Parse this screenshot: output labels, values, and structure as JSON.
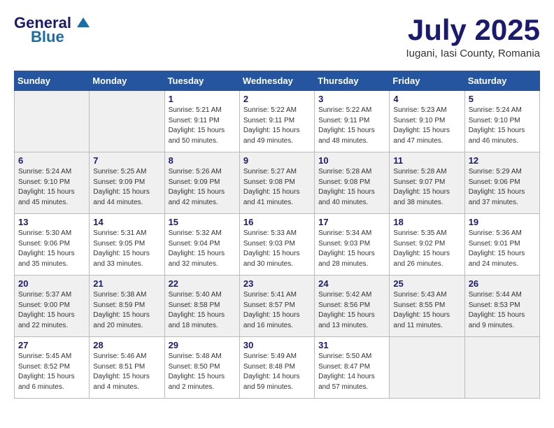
{
  "header": {
    "logo_general": "General",
    "logo_blue": "Blue",
    "month_year": "July 2025",
    "location": "Iugani, Iasi County, Romania"
  },
  "weekdays": [
    "Sunday",
    "Monday",
    "Tuesday",
    "Wednesday",
    "Thursday",
    "Friday",
    "Saturday"
  ],
  "weeks": [
    [
      {
        "day": "",
        "detail": ""
      },
      {
        "day": "",
        "detail": ""
      },
      {
        "day": "1",
        "detail": "Sunrise: 5:21 AM\nSunset: 9:11 PM\nDaylight: 15 hours\nand 50 minutes."
      },
      {
        "day": "2",
        "detail": "Sunrise: 5:22 AM\nSunset: 9:11 PM\nDaylight: 15 hours\nand 49 minutes."
      },
      {
        "day": "3",
        "detail": "Sunrise: 5:22 AM\nSunset: 9:11 PM\nDaylight: 15 hours\nand 48 minutes."
      },
      {
        "day": "4",
        "detail": "Sunrise: 5:23 AM\nSunset: 9:10 PM\nDaylight: 15 hours\nand 47 minutes."
      },
      {
        "day": "5",
        "detail": "Sunrise: 5:24 AM\nSunset: 9:10 PM\nDaylight: 15 hours\nand 46 minutes."
      }
    ],
    [
      {
        "day": "6",
        "detail": "Sunrise: 5:24 AM\nSunset: 9:10 PM\nDaylight: 15 hours\nand 45 minutes."
      },
      {
        "day": "7",
        "detail": "Sunrise: 5:25 AM\nSunset: 9:09 PM\nDaylight: 15 hours\nand 44 minutes."
      },
      {
        "day": "8",
        "detail": "Sunrise: 5:26 AM\nSunset: 9:09 PM\nDaylight: 15 hours\nand 42 minutes."
      },
      {
        "day": "9",
        "detail": "Sunrise: 5:27 AM\nSunset: 9:08 PM\nDaylight: 15 hours\nand 41 minutes."
      },
      {
        "day": "10",
        "detail": "Sunrise: 5:28 AM\nSunset: 9:08 PM\nDaylight: 15 hours\nand 40 minutes."
      },
      {
        "day": "11",
        "detail": "Sunrise: 5:28 AM\nSunset: 9:07 PM\nDaylight: 15 hours\nand 38 minutes."
      },
      {
        "day": "12",
        "detail": "Sunrise: 5:29 AM\nSunset: 9:06 PM\nDaylight: 15 hours\nand 37 minutes."
      }
    ],
    [
      {
        "day": "13",
        "detail": "Sunrise: 5:30 AM\nSunset: 9:06 PM\nDaylight: 15 hours\nand 35 minutes."
      },
      {
        "day": "14",
        "detail": "Sunrise: 5:31 AM\nSunset: 9:05 PM\nDaylight: 15 hours\nand 33 minutes."
      },
      {
        "day": "15",
        "detail": "Sunrise: 5:32 AM\nSunset: 9:04 PM\nDaylight: 15 hours\nand 32 minutes."
      },
      {
        "day": "16",
        "detail": "Sunrise: 5:33 AM\nSunset: 9:03 PM\nDaylight: 15 hours\nand 30 minutes."
      },
      {
        "day": "17",
        "detail": "Sunrise: 5:34 AM\nSunset: 9:03 PM\nDaylight: 15 hours\nand 28 minutes."
      },
      {
        "day": "18",
        "detail": "Sunrise: 5:35 AM\nSunset: 9:02 PM\nDaylight: 15 hours\nand 26 minutes."
      },
      {
        "day": "19",
        "detail": "Sunrise: 5:36 AM\nSunset: 9:01 PM\nDaylight: 15 hours\nand 24 minutes."
      }
    ],
    [
      {
        "day": "20",
        "detail": "Sunrise: 5:37 AM\nSunset: 9:00 PM\nDaylight: 15 hours\nand 22 minutes."
      },
      {
        "day": "21",
        "detail": "Sunrise: 5:38 AM\nSunset: 8:59 PM\nDaylight: 15 hours\nand 20 minutes."
      },
      {
        "day": "22",
        "detail": "Sunrise: 5:40 AM\nSunset: 8:58 PM\nDaylight: 15 hours\nand 18 minutes."
      },
      {
        "day": "23",
        "detail": "Sunrise: 5:41 AM\nSunset: 8:57 PM\nDaylight: 15 hours\nand 16 minutes."
      },
      {
        "day": "24",
        "detail": "Sunrise: 5:42 AM\nSunset: 8:56 PM\nDaylight: 15 hours\nand 13 minutes."
      },
      {
        "day": "25",
        "detail": "Sunrise: 5:43 AM\nSunset: 8:55 PM\nDaylight: 15 hours\nand 11 minutes."
      },
      {
        "day": "26",
        "detail": "Sunrise: 5:44 AM\nSunset: 8:53 PM\nDaylight: 15 hours\nand 9 minutes."
      }
    ],
    [
      {
        "day": "27",
        "detail": "Sunrise: 5:45 AM\nSunset: 8:52 PM\nDaylight: 15 hours\nand 6 minutes."
      },
      {
        "day": "28",
        "detail": "Sunrise: 5:46 AM\nSunset: 8:51 PM\nDaylight: 15 hours\nand 4 minutes."
      },
      {
        "day": "29",
        "detail": "Sunrise: 5:48 AM\nSunset: 8:50 PM\nDaylight: 15 hours\nand 2 minutes."
      },
      {
        "day": "30",
        "detail": "Sunrise: 5:49 AM\nSunset: 8:48 PM\nDaylight: 14 hours\nand 59 minutes."
      },
      {
        "day": "31",
        "detail": "Sunrise: 5:50 AM\nSunset: 8:47 PM\nDaylight: 14 hours\nand 57 minutes."
      },
      {
        "day": "",
        "detail": ""
      },
      {
        "day": "",
        "detail": ""
      }
    ]
  ]
}
